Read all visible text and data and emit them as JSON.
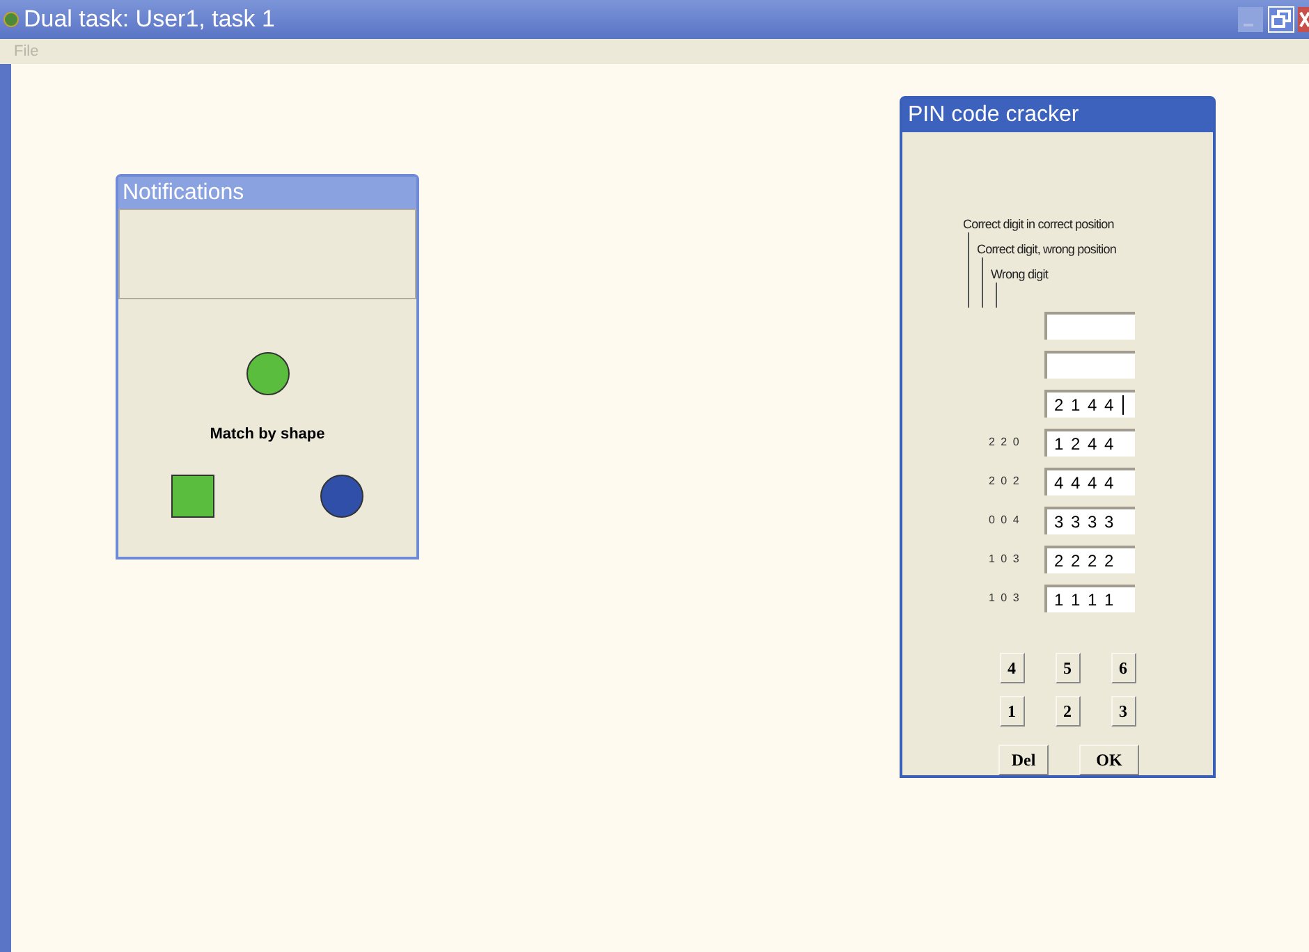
{
  "window": {
    "title": "Dual task: User1, task 1"
  },
  "menu": [
    {
      "label": "File",
      "disabled": true
    }
  ],
  "notifications": {
    "title": "Notifications",
    "prompt": "Match by shape",
    "target": {
      "kind": "circle",
      "color": "#5bbd3e"
    },
    "options": [
      {
        "kind": "square",
        "color": "#5bbd3e"
      },
      {
        "kind": "circle",
        "color": "#2f4fa8"
      }
    ]
  },
  "pin_cracker": {
    "title": "PIN code cracker",
    "legend": [
      "Correct digit in correct position",
      "Correct digit, wrong position",
      "Wrong digit"
    ],
    "fields": [
      {
        "focused": false
      },
      {
        "focused": false
      },
      {
        "value": "2 1 4 4",
        "focused": true
      }
    ],
    "attempts": [
      {
        "feedback": "2 2 0",
        "guess": "1 2 4 4"
      },
      {
        "feedback": "2 0 2",
        "guess": "4 4 4 4"
      },
      {
        "feedback": "0 0 4",
        "guess": "3 3 3 3"
      },
      {
        "feedback": "1 0 3",
        "guess": "2 2 2 2"
      },
      {
        "feedback": "1 0 3",
        "guess": "1 1 1 1"
      }
    ],
    "keypad": [
      "4",
      "5",
      "6",
      "1",
      "2",
      "3"
    ],
    "actions": [
      "Del",
      "OK"
    ]
  }
}
